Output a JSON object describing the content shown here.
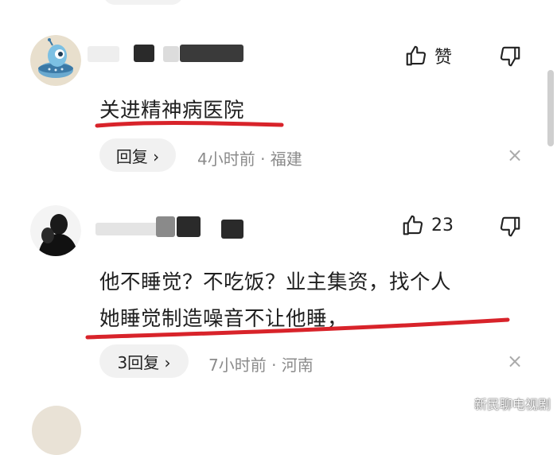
{
  "comments": [
    {
      "like_label": "赞",
      "text": "关进精神病医院",
      "reply_label": "回复 ›",
      "meta": "4小时前 · 福建"
    },
    {
      "like_label": "23",
      "text_line1": "他不睡觉？不吃饭？业主集资，找个人",
      "text_line2": "她睡觉制造噪音不让他睡，",
      "reply_label": "3回复 ›",
      "meta": "7小时前 · 河南"
    }
  ],
  "close_symbol": "×",
  "watermark": "新民聊电视剧",
  "colors": {
    "annotation": "#d8232a",
    "meta": "#8b8b8b",
    "reply_bg": "#f1f1f1"
  },
  "icons": [
    "thumb-up-icon",
    "thumb-down-icon",
    "close-icon"
  ]
}
